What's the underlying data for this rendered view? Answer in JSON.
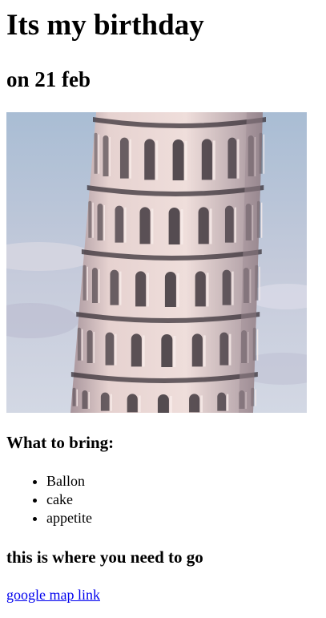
{
  "header": {
    "title": "Its my birthday",
    "subtitle": "on 21 feb"
  },
  "image": {
    "subject": "leaning tower of pisa",
    "colors": {
      "sky_top": "#a9bdd4",
      "sky_bottom": "#cfd6e2",
      "tower_light": "#ead8d6",
      "tower_shade": "#9e8c93",
      "arch_dark": "#3a3238"
    }
  },
  "bring": {
    "heading": "What to bring:",
    "items": [
      "Ballon",
      "cake",
      "appetite"
    ]
  },
  "directions": {
    "heading": "this is where you need to go",
    "link_label": "google map link",
    "link_color": "#0000ee"
  }
}
